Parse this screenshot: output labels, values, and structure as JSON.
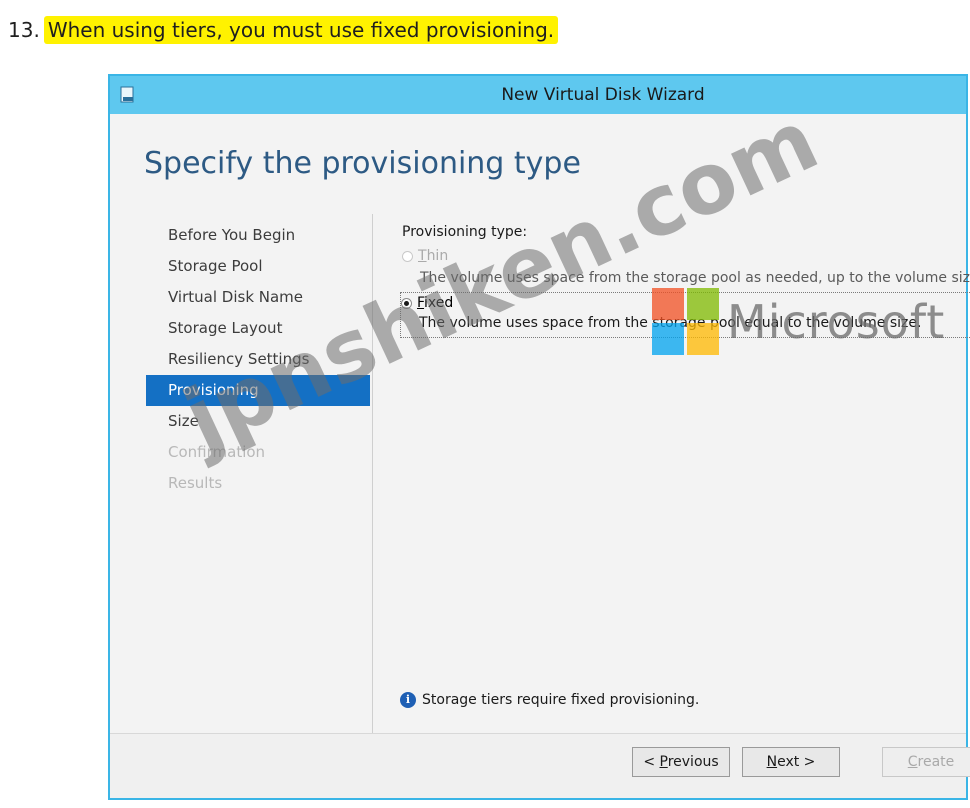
{
  "note": {
    "number": "13.",
    "text": "When using tiers, you must use fixed provisioning."
  },
  "window": {
    "title": "New Virtual Disk Wizard"
  },
  "page": {
    "heading": "Specify the provisioning type"
  },
  "steps": [
    {
      "label": "Before You Begin",
      "state": "normal"
    },
    {
      "label": "Storage Pool",
      "state": "normal"
    },
    {
      "label": "Virtual Disk Name",
      "state": "normal"
    },
    {
      "label": "Storage Layout",
      "state": "normal"
    },
    {
      "label": "Resiliency Settings",
      "state": "normal"
    },
    {
      "label": "Provisioning",
      "state": "active"
    },
    {
      "label": "Size",
      "state": "normal"
    },
    {
      "label": "Confirmation",
      "state": "disabled"
    },
    {
      "label": "Results",
      "state": "disabled"
    }
  ],
  "provisioning": {
    "label": "Provisioning type:",
    "thin": {
      "label": "Thin",
      "description": "The volume uses space from the storage pool as needed, up to the volume size.",
      "selected": false,
      "enabled": false
    },
    "fixed": {
      "label": "Fixed",
      "description": "The volume uses space from the storage pool equal to the volume size.",
      "selected": true,
      "enabled": true
    }
  },
  "info": {
    "icon": "info-icon",
    "text": "Storage tiers require fixed provisioning."
  },
  "buttons": {
    "previous": "< Previous",
    "next": "Next >",
    "create": "Create"
  },
  "overlays": {
    "logo_text": "Microsoft",
    "logo_colors": [
      "#f25022",
      "#7fba00",
      "#00a4ef",
      "#ffb900"
    ],
    "watermark": "jpnshiken.com"
  },
  "colors": {
    "titlebar": "#5ec8ef",
    "active_step": "#1470c4",
    "heading": "#2d5a84",
    "highlight": "#fff200"
  }
}
